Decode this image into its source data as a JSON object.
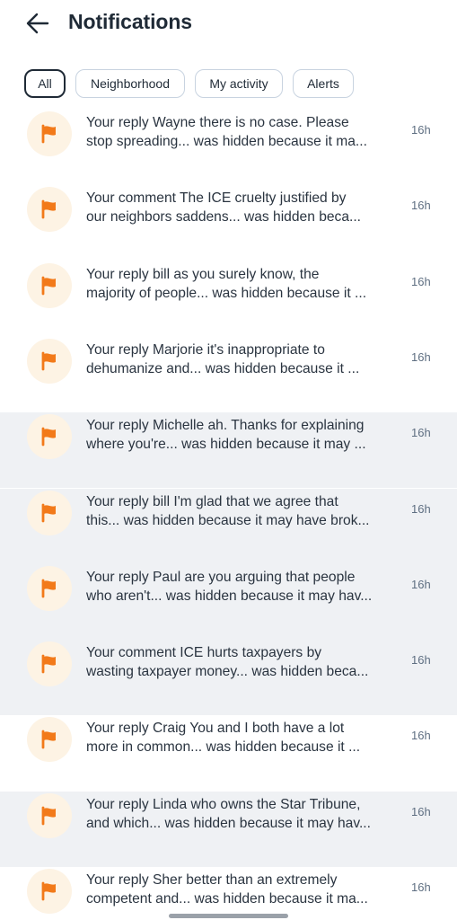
{
  "header": {
    "title": "Notifications"
  },
  "chips": [
    "All",
    "Neighborhood",
    "My activity",
    "Alerts"
  ],
  "notifications": [
    {
      "line1": "Your reply Wayne there is no case. Please",
      "line2": "stop spreading... was hidden because it ma...",
      "time": "16h"
    },
    {
      "line1": "Your comment The ICE cruelty justified by",
      "line2": "our neighbors saddens... was hidden beca...",
      "time": "16h"
    },
    {
      "line1": "Your reply bill as you surely know, the",
      "line2": "majority of people... was hidden because it ...",
      "time": "16h"
    },
    {
      "line1": "Your reply Marjorie it's inappropriate to",
      "line2": "dehumanize and... was hidden because it ...",
      "time": "16h"
    },
    {
      "line1": "Your reply Michelle ah. Thanks for explaining",
      "line2": "where you're... was hidden because it may ...",
      "time": "16h"
    },
    {
      "line1": "Your reply bill I'm glad that we agree that",
      "line2": "this... was hidden because it may have brok...",
      "time": "16h"
    },
    {
      "line1": "Your reply Paul are you arguing that people",
      "line2": "who aren't... was hidden because it may hav...",
      "time": "16h"
    },
    {
      "line1": "Your comment ICE hurts taxpayers by",
      "line2": "wasting taxpayer money... was hidden beca...",
      "time": "16h"
    },
    {
      "line1": "Your reply Craig You and I both have a lot",
      "line2": "more in common... was hidden because it ...",
      "time": "16h"
    },
    {
      "line1": "Your reply Linda who owns the Star Tribune,",
      "line2": "and which... was hidden because it may hav...",
      "time": "16h"
    },
    {
      "line1": "Your reply Sher better than an extremely",
      "line2": "competent and... was hidden because it ma...",
      "time": "16h"
    }
  ]
}
